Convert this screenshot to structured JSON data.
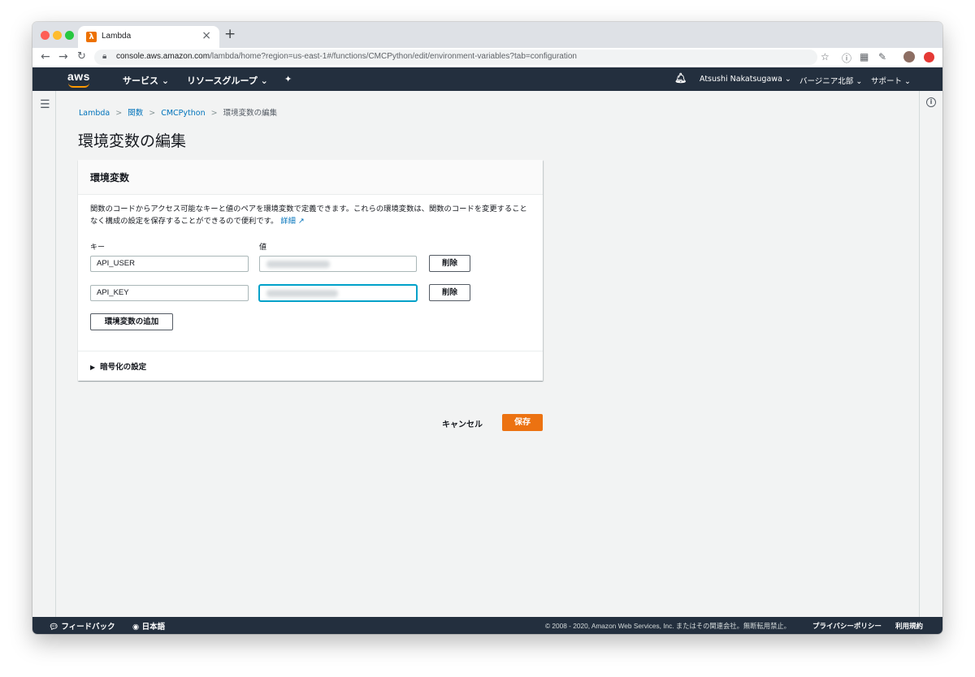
{
  "browser": {
    "tab_title": "Lambda",
    "tab_favicon": "λ",
    "new_tab": "+",
    "close_tab": "×",
    "url_host": "console.aws.amazon.com",
    "url_path": "/lambda/home?region=us-east-1#/functions/CMCPython/edit/environment-variables?tab=configuration"
  },
  "aws_nav": {
    "logo": "aws",
    "services": "サービス ⌄",
    "resource_groups": "リソースグループ ⌄",
    "pin": "✦",
    "user": "Atsushi Nakatsugawa ⌄",
    "region": "バージニア北部 ⌄",
    "support": "サポート ⌄"
  },
  "breadcrumb": {
    "items": [
      "Lambda",
      "関数",
      "CMCPython"
    ],
    "current": "環境変数の編集",
    "separator": ">"
  },
  "page_title": "環境変数の編集",
  "panel": {
    "title": "環境変数",
    "description": "関数のコードからアクセス可能なキーと値のペアを環境変数で定義できます。これらの環境変数は、関数のコードを変更することなく構成の設定を保存することができるので便利です。",
    "details_link": "詳細",
    "key_label": "キー",
    "value_label": "値",
    "rows": [
      {
        "key": "API_USER",
        "delete": "削除"
      },
      {
        "key": "API_KEY",
        "delete": "削除"
      }
    ],
    "add_button": "環境変数の追加",
    "encryption": "暗号化の設定"
  },
  "actions": {
    "cancel": "キャンセル",
    "save": "保存"
  },
  "footer": {
    "feedback": "フィードバック",
    "language": "日本語",
    "copyright": "© 2008 - 2020, Amazon Web Services, Inc. またはその関連会社。無断転用禁止。",
    "privacy": "プライバシーポリシー",
    "terms": "利用規約"
  },
  "colors": {
    "aws_nav": "#232f3e",
    "primary": "#ec7211",
    "link": "#0073bb",
    "focus": "#00a1c9"
  }
}
